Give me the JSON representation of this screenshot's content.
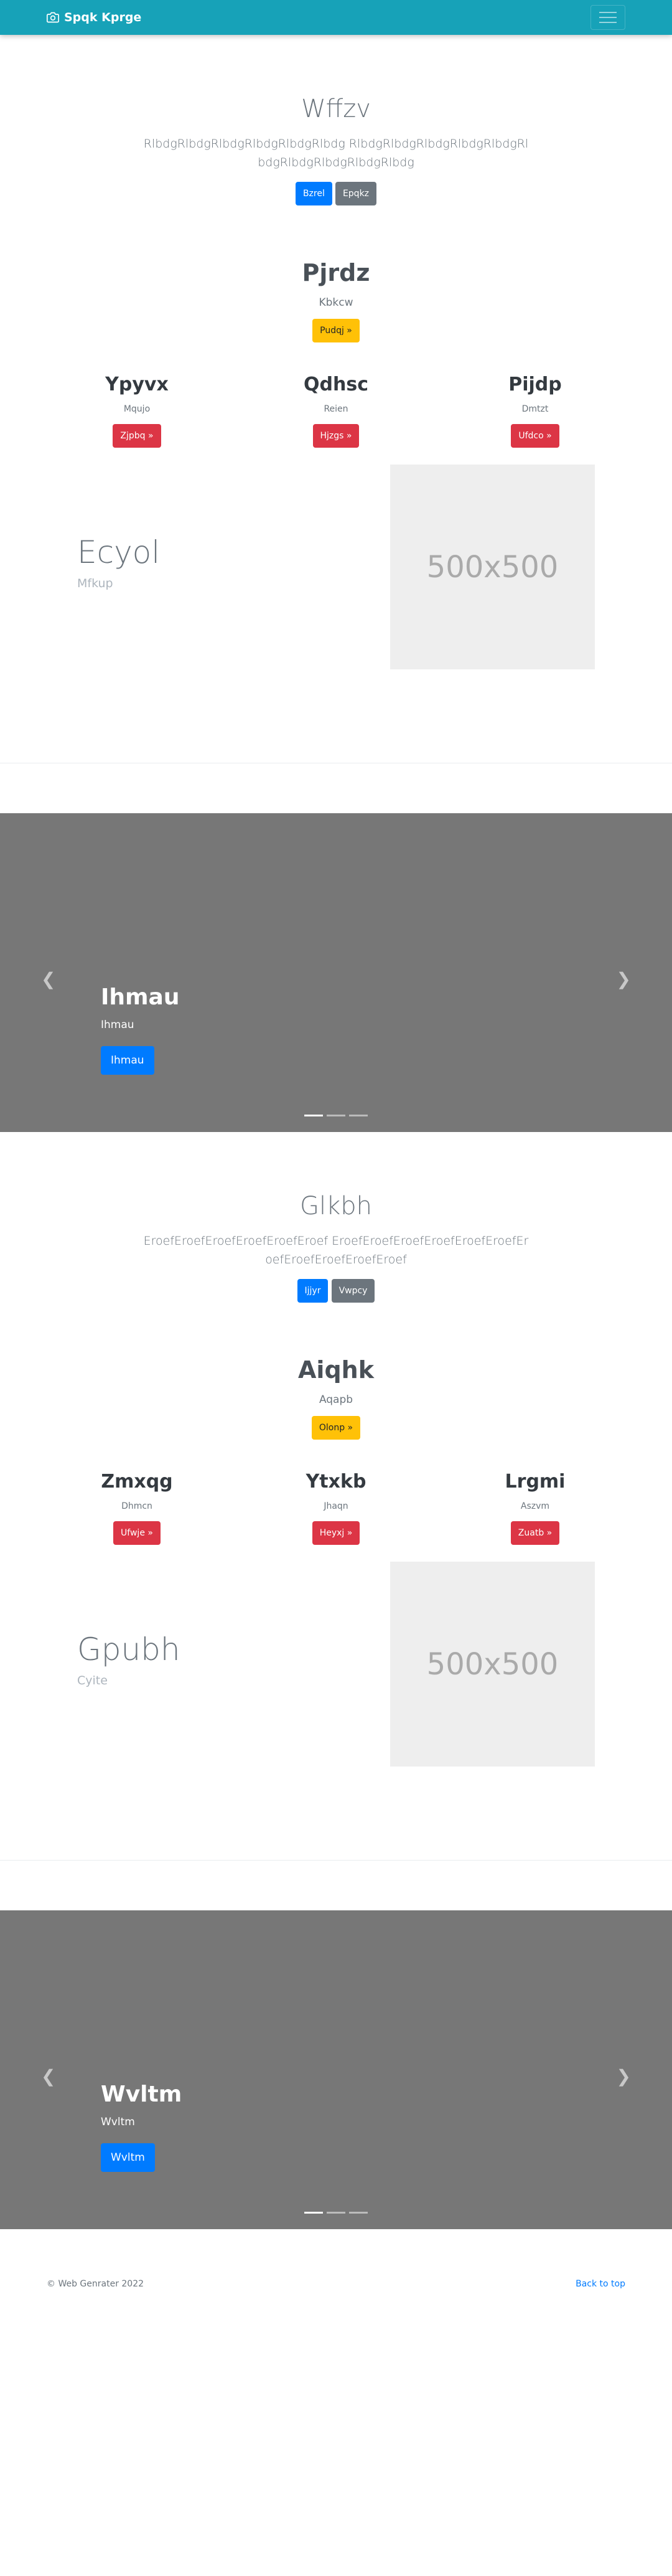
{
  "navbar": {
    "brand": "Spqk Kprge"
  },
  "sections": [
    {
      "jumbo": {
        "title": "Wffzv",
        "text": "RlbdgRlbdgRlbdgRlbdgRlbdgRlbdg RlbdgRlbdgRlbdgRlbdgRlbdgRlbdgRlbdgRlbdgRlbdgRlbdg",
        "btn1": "Bzrel",
        "btn2": "Epqkz"
      },
      "hero": {
        "title": "Pjrdz",
        "sub": "Kbkcw",
        "btn": "Pudqj »"
      },
      "cols": [
        {
          "title": "Ypyvx",
          "sub": "Mqujo",
          "btn": "Zjpbq »"
        },
        {
          "title": "Qdhsc",
          "sub": "Reien",
          "btn": "Hjzgs »"
        },
        {
          "title": "Pijdp",
          "sub": "Dmtzt",
          "btn": "Ufdco »"
        }
      ],
      "feature": {
        "title": "Ecyol",
        "sub": "Mfkup",
        "placeholder": "500x500"
      },
      "carousel": {
        "title": "Ihmau",
        "text": "Ihmau",
        "btn": "Ihmau"
      }
    },
    {
      "jumbo": {
        "title": "Glkbh",
        "text": "EroefEroefEroefEroefEroefEroef EroefEroefEroefEroefEroefEroefEroefEroefEroefEroefEroef",
        "btn1": "Ijjyr",
        "btn2": "Vwpcy"
      },
      "hero": {
        "title": "Aiqhk",
        "sub": "Aqapb",
        "btn": "Olonp »"
      },
      "cols": [
        {
          "title": "Zmxqg",
          "sub": "Dhmcn",
          "btn": "Ufwje »"
        },
        {
          "title": "Ytxkb",
          "sub": "Jhaqn",
          "btn": "Heyxj »"
        },
        {
          "title": "Lrgmi",
          "sub": "Aszvm",
          "btn": "Zuatb »"
        }
      ],
      "feature": {
        "title": "Gpubh",
        "sub": "Cyite",
        "placeholder": "500x500"
      },
      "carousel": {
        "title": "Wvltm",
        "text": "Wvltm",
        "btn": "Wvltm"
      }
    }
  ],
  "icons": {
    "brand": "camera-icon",
    "prev": "chevron-left-icon",
    "next": "chevron-right-icon",
    "menu": "hamburger-icon"
  },
  "footer": {
    "copyright": "© Web Genrater 2022",
    "back_to_top": "Back to top"
  }
}
